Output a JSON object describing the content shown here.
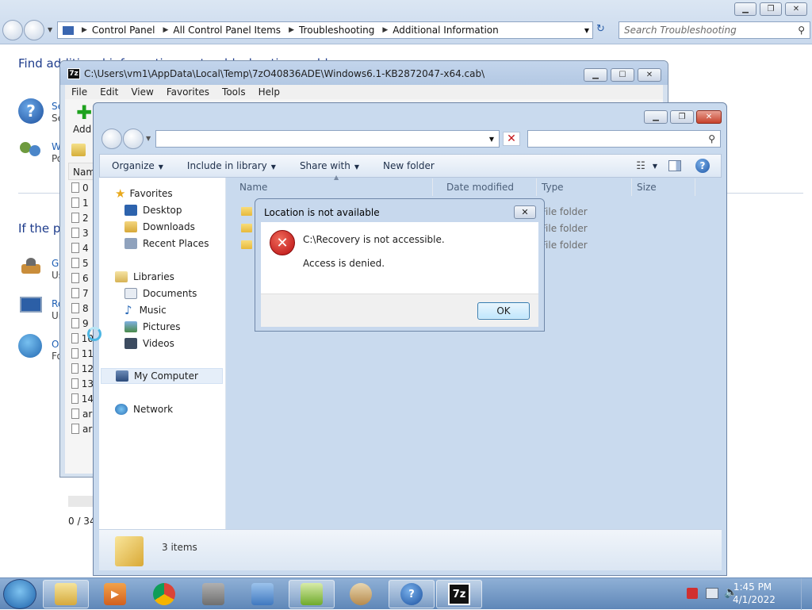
{
  "control_panel": {
    "breadcrumbs": [
      "Control Panel",
      "All Control Panel Items",
      "Troubleshooting",
      "Additional Information"
    ],
    "search_placeholder": "Search Troubleshooting",
    "heading": "Find additional information on troubleshooting problems",
    "heading2": "If the problem persists",
    "links": [
      {
        "title": "Se",
        "sub": "Se"
      },
      {
        "title": "W",
        "sub": "Po"
      },
      {
        "title": "Ge",
        "sub": "Us"
      },
      {
        "title": "Re",
        "sub": "Ur"
      },
      {
        "title": "O",
        "sub": "Fo"
      }
    ]
  },
  "sevenzip": {
    "title": "C:\\Users\\vm1\\AppData\\Local\\Temp\\7zO40836ADE\\Windows6.1-KB2872047-x64.cab\\",
    "menu": [
      "File",
      "Edit",
      "View",
      "Favorites",
      "Tools",
      "Help"
    ],
    "add_label": "Add",
    "column_name": "Nam",
    "rows": [
      "0",
      "1",
      "2",
      "3",
      "4",
      "5",
      "6",
      "7",
      "8",
      "9",
      "10",
      "11",
      "12",
      "13",
      "14",
      "ar",
      "ar"
    ],
    "status": "0 / 34"
  },
  "explorer": {
    "toolbar": [
      "Organize",
      "Include in library",
      "Share with",
      "New folder"
    ],
    "columns": [
      "Name",
      "Date modified",
      "Type",
      "Size"
    ],
    "type_values": [
      "File folder",
      "File folder",
      "File folder"
    ],
    "nav": {
      "favorites": "Favorites",
      "desktop": "Desktop",
      "downloads": "Downloads",
      "recent": "Recent Places",
      "libraries": "Libraries",
      "documents": "Documents",
      "music": "Music",
      "pictures": "Pictures",
      "videos": "Videos",
      "computer": "My Computer",
      "network": "Network"
    },
    "items_count": "3 items"
  },
  "dialog": {
    "title": "Location is not available",
    "message": "C:\\Recovery is not accessible.",
    "detail": "Access is denied.",
    "ok": "OK"
  },
  "taskbar": {
    "time": "1:45 PM",
    "date": "4/1/2022",
    "sevenzip_label": "7z"
  },
  "colors": {
    "accent": "#1e5fb4",
    "error": "#c4161b",
    "taskbar": "#6d93c2"
  }
}
